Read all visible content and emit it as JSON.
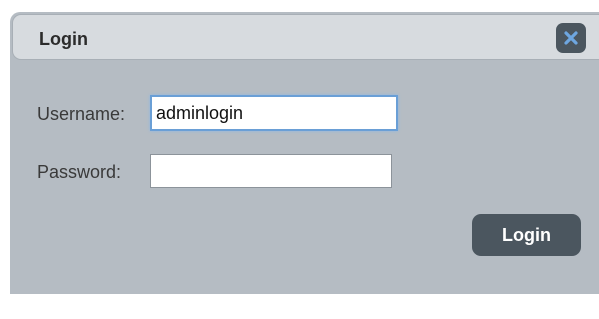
{
  "dialog": {
    "title": "Login",
    "close_icon": "close-icon"
  },
  "form": {
    "username_label": "Username:",
    "username_value": "adminlogin",
    "password_label": "Password:",
    "password_value": ""
  },
  "actions": {
    "login_label": "Login"
  },
  "colors": {
    "dialog_bg": "#b5bcc3",
    "titlebar_bg": "#d7dbdf",
    "button_bg": "#4b565f",
    "focus_border": "#6a9fd6",
    "close_icon": "#6ea6e0"
  }
}
